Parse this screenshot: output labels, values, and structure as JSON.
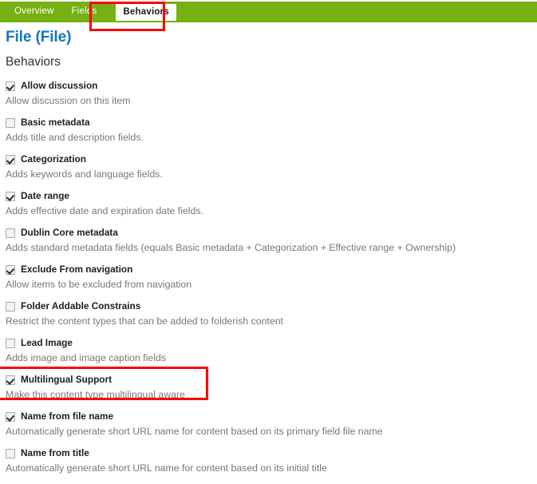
{
  "tabs": [
    {
      "label": "Overview",
      "selected": false
    },
    {
      "label": "Fields",
      "selected": false
    },
    {
      "label": "Behaviors",
      "selected": true
    }
  ],
  "page": {
    "title": "File (File)",
    "section_title": "Behaviors"
  },
  "colors": {
    "tabbar_green": "#76b013",
    "title_blue": "#1279b4",
    "annotation_red": "#fe0000",
    "label_text": "#1e1e1e",
    "desc_text": "#777777"
  },
  "behaviors": [
    {
      "label": "Allow discussion",
      "description": "Allow discussion on this item",
      "checked": true
    },
    {
      "label": "Basic metadata",
      "description": "Adds title and description fields.",
      "checked": false
    },
    {
      "label": "Categorization",
      "description": "Adds keywords and language fields.",
      "checked": true
    },
    {
      "label": "Date range",
      "description": "Adds effective date and expiration date fields.",
      "checked": true
    },
    {
      "label": "Dublin Core metadata",
      "description": "Adds standard metadata fields (equals Basic metadata + Categorization + Effective range + Ownership)",
      "checked": false
    },
    {
      "label": "Exclude From navigation",
      "description": "Allow items to be excluded from navigation",
      "checked": true
    },
    {
      "label": "Folder Addable Constrains",
      "description": "Restrict the content types that can be added to folderish content",
      "checked": false
    },
    {
      "label": "Lead Image",
      "description": "Adds image and image caption fields",
      "checked": false
    },
    {
      "label": "Multilingual Support",
      "description": "Make this content type multilingual aware",
      "checked": true
    },
    {
      "label": "Name from file name",
      "description": "Automatically generate short URL name for content based on its primary field file name",
      "checked": true
    },
    {
      "label": "Name from title",
      "description": "Automatically generate short URL name for content based on its initial title",
      "checked": false
    }
  ],
  "annotations": [
    {
      "name": "behaviors-tab-highlight"
    },
    {
      "name": "multilingual-support-highlight"
    }
  ]
}
